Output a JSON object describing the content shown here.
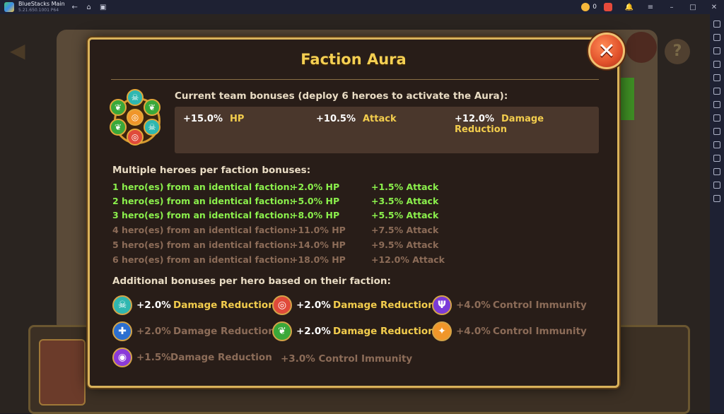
{
  "window": {
    "title": "BlueStacks Main",
    "subtitle": "5.21.650.1001 P64",
    "coins": "0"
  },
  "dialog": {
    "title": "Faction Aura",
    "current_label": "Current team bonuses (deploy 6 heroes to activate the Aura):",
    "current": [
      {
        "value": "+15.0%",
        "name": "HP"
      },
      {
        "value": "+10.5%",
        "name": "Attack"
      },
      {
        "value": "+12.0%",
        "name": "Damage Reduction"
      }
    ],
    "multi_label": "Multiple heroes per faction bonuses:",
    "multi_rows": [
      {
        "desc": "1 hero(es) from an identical faction:",
        "hp": "+2.0% HP",
        "atk": "+1.5% Attack",
        "active": true
      },
      {
        "desc": "2 hero(es) from an identical faction:",
        "hp": "+5.0% HP",
        "atk": "+3.5% Attack",
        "active": true
      },
      {
        "desc": "3 hero(es) from an identical faction:",
        "hp": "+8.0% HP",
        "atk": "+5.5% Attack",
        "active": true
      },
      {
        "desc": "4 hero(es) from an identical faction:",
        "hp": "+11.0% HP",
        "atk": "+7.5% Attack",
        "active": false
      },
      {
        "desc": "5 hero(es) from an identical faction:",
        "hp": "+14.0% HP",
        "atk": "+9.5% Attack",
        "active": false
      },
      {
        "desc": "6 hero(es) from an identical faction:",
        "hp": "+18.0% HP",
        "atk": "+12.0% Attack",
        "active": false
      }
    ],
    "faction_label": "Additional bonuses per hero based on their faction:",
    "factions": [
      {
        "icon": "skull-faction-icon",
        "color": "#2fb7b0",
        "glyph": "☠",
        "value": "+2.0%",
        "name": "Damage Reduction",
        "active": true
      },
      {
        "icon": "swirl-faction-icon",
        "color": "#e04a3a",
        "glyph": "◎",
        "value": "+2.0%",
        "name": "Damage Reduction",
        "active": true
      },
      {
        "icon": "trident-faction-icon",
        "color": "#7a3ad8",
        "glyph": "Ψ",
        "value": "+4.0%",
        "name": "Control Immunity",
        "active": false
      },
      {
        "icon": "cross-faction-icon",
        "color": "#2c6fd0",
        "glyph": "✚",
        "value": "+2.0%",
        "name": "Damage Reduction",
        "active": false
      },
      {
        "icon": "leaf-faction-icon",
        "color": "#3aa83a",
        "glyph": "❦",
        "value": "+2.0%",
        "name": "Damage Reduction",
        "active": true
      },
      {
        "icon": "flame-faction-icon",
        "color": "#f0962a",
        "glyph": "✦",
        "value": "+4.0%",
        "name": "Control Immunity",
        "active": false
      },
      {
        "icon": "orb-faction-icon",
        "color": "#8a3ad8",
        "glyph": "◉",
        "value": "+1.5%",
        "name": "Damage Reduction",
        "active": false
      }
    ],
    "extra_bonus": "+3.0% Control Immunity"
  }
}
